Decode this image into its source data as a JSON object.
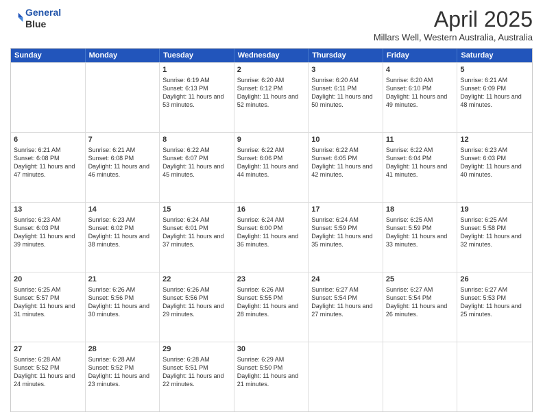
{
  "header": {
    "logo_line1": "General",
    "logo_line2": "Blue",
    "month_year": "April 2025",
    "location": "Millars Well, Western Australia, Australia"
  },
  "days_of_week": [
    "Sunday",
    "Monday",
    "Tuesday",
    "Wednesday",
    "Thursday",
    "Friday",
    "Saturday"
  ],
  "weeks": [
    [
      {
        "day": "",
        "sunrise": "",
        "sunset": "",
        "daylight": ""
      },
      {
        "day": "",
        "sunrise": "",
        "sunset": "",
        "daylight": ""
      },
      {
        "day": "1",
        "sunrise": "Sunrise: 6:19 AM",
        "sunset": "Sunset: 6:13 PM",
        "daylight": "Daylight: 11 hours and 53 minutes."
      },
      {
        "day": "2",
        "sunrise": "Sunrise: 6:20 AM",
        "sunset": "Sunset: 6:12 PM",
        "daylight": "Daylight: 11 hours and 52 minutes."
      },
      {
        "day": "3",
        "sunrise": "Sunrise: 6:20 AM",
        "sunset": "Sunset: 6:11 PM",
        "daylight": "Daylight: 11 hours and 50 minutes."
      },
      {
        "day": "4",
        "sunrise": "Sunrise: 6:20 AM",
        "sunset": "Sunset: 6:10 PM",
        "daylight": "Daylight: 11 hours and 49 minutes."
      },
      {
        "day": "5",
        "sunrise": "Sunrise: 6:21 AM",
        "sunset": "Sunset: 6:09 PM",
        "daylight": "Daylight: 11 hours and 48 minutes."
      }
    ],
    [
      {
        "day": "6",
        "sunrise": "Sunrise: 6:21 AM",
        "sunset": "Sunset: 6:08 PM",
        "daylight": "Daylight: 11 hours and 47 minutes."
      },
      {
        "day": "7",
        "sunrise": "Sunrise: 6:21 AM",
        "sunset": "Sunset: 6:08 PM",
        "daylight": "Daylight: 11 hours and 46 minutes."
      },
      {
        "day": "8",
        "sunrise": "Sunrise: 6:22 AM",
        "sunset": "Sunset: 6:07 PM",
        "daylight": "Daylight: 11 hours and 45 minutes."
      },
      {
        "day": "9",
        "sunrise": "Sunrise: 6:22 AM",
        "sunset": "Sunset: 6:06 PM",
        "daylight": "Daylight: 11 hours and 44 minutes."
      },
      {
        "day": "10",
        "sunrise": "Sunrise: 6:22 AM",
        "sunset": "Sunset: 6:05 PM",
        "daylight": "Daylight: 11 hours and 42 minutes."
      },
      {
        "day": "11",
        "sunrise": "Sunrise: 6:22 AM",
        "sunset": "Sunset: 6:04 PM",
        "daylight": "Daylight: 11 hours and 41 minutes."
      },
      {
        "day": "12",
        "sunrise": "Sunrise: 6:23 AM",
        "sunset": "Sunset: 6:03 PM",
        "daylight": "Daylight: 11 hours and 40 minutes."
      }
    ],
    [
      {
        "day": "13",
        "sunrise": "Sunrise: 6:23 AM",
        "sunset": "Sunset: 6:03 PM",
        "daylight": "Daylight: 11 hours and 39 minutes."
      },
      {
        "day": "14",
        "sunrise": "Sunrise: 6:23 AM",
        "sunset": "Sunset: 6:02 PM",
        "daylight": "Daylight: 11 hours and 38 minutes."
      },
      {
        "day": "15",
        "sunrise": "Sunrise: 6:24 AM",
        "sunset": "Sunset: 6:01 PM",
        "daylight": "Daylight: 11 hours and 37 minutes."
      },
      {
        "day": "16",
        "sunrise": "Sunrise: 6:24 AM",
        "sunset": "Sunset: 6:00 PM",
        "daylight": "Daylight: 11 hours and 36 minutes."
      },
      {
        "day": "17",
        "sunrise": "Sunrise: 6:24 AM",
        "sunset": "Sunset: 5:59 PM",
        "daylight": "Daylight: 11 hours and 35 minutes."
      },
      {
        "day": "18",
        "sunrise": "Sunrise: 6:25 AM",
        "sunset": "Sunset: 5:59 PM",
        "daylight": "Daylight: 11 hours and 33 minutes."
      },
      {
        "day": "19",
        "sunrise": "Sunrise: 6:25 AM",
        "sunset": "Sunset: 5:58 PM",
        "daylight": "Daylight: 11 hours and 32 minutes."
      }
    ],
    [
      {
        "day": "20",
        "sunrise": "Sunrise: 6:25 AM",
        "sunset": "Sunset: 5:57 PM",
        "daylight": "Daylight: 11 hours and 31 minutes."
      },
      {
        "day": "21",
        "sunrise": "Sunrise: 6:26 AM",
        "sunset": "Sunset: 5:56 PM",
        "daylight": "Daylight: 11 hours and 30 minutes."
      },
      {
        "day": "22",
        "sunrise": "Sunrise: 6:26 AM",
        "sunset": "Sunset: 5:56 PM",
        "daylight": "Daylight: 11 hours and 29 minutes."
      },
      {
        "day": "23",
        "sunrise": "Sunrise: 6:26 AM",
        "sunset": "Sunset: 5:55 PM",
        "daylight": "Daylight: 11 hours and 28 minutes."
      },
      {
        "day": "24",
        "sunrise": "Sunrise: 6:27 AM",
        "sunset": "Sunset: 5:54 PM",
        "daylight": "Daylight: 11 hours and 27 minutes."
      },
      {
        "day": "25",
        "sunrise": "Sunrise: 6:27 AM",
        "sunset": "Sunset: 5:54 PM",
        "daylight": "Daylight: 11 hours and 26 minutes."
      },
      {
        "day": "26",
        "sunrise": "Sunrise: 6:27 AM",
        "sunset": "Sunset: 5:53 PM",
        "daylight": "Daylight: 11 hours and 25 minutes."
      }
    ],
    [
      {
        "day": "27",
        "sunrise": "Sunrise: 6:28 AM",
        "sunset": "Sunset: 5:52 PM",
        "daylight": "Daylight: 11 hours and 24 minutes."
      },
      {
        "day": "28",
        "sunrise": "Sunrise: 6:28 AM",
        "sunset": "Sunset: 5:52 PM",
        "daylight": "Daylight: 11 hours and 23 minutes."
      },
      {
        "day": "29",
        "sunrise": "Sunrise: 6:28 AM",
        "sunset": "Sunset: 5:51 PM",
        "daylight": "Daylight: 11 hours and 22 minutes."
      },
      {
        "day": "30",
        "sunrise": "Sunrise: 6:29 AM",
        "sunset": "Sunset: 5:50 PM",
        "daylight": "Daylight: 11 hours and 21 minutes."
      },
      {
        "day": "",
        "sunrise": "",
        "sunset": "",
        "daylight": ""
      },
      {
        "day": "",
        "sunrise": "",
        "sunset": "",
        "daylight": ""
      },
      {
        "day": "",
        "sunrise": "",
        "sunset": "",
        "daylight": ""
      }
    ]
  ]
}
